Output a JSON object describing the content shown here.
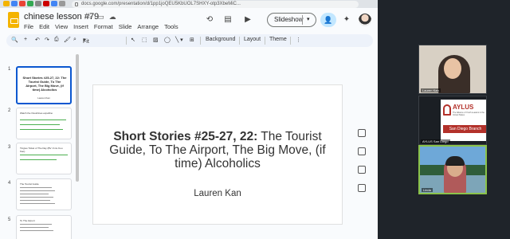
{
  "browser": {
    "url": "docs.google.com/presentation/d/1pp1joQEU5KbUOL7SHXY-otp3XbeMiC..."
  },
  "app": {
    "title": "chinese lesson #79",
    "menus": [
      "File",
      "Edit",
      "View",
      "Insert",
      "Format",
      "Slide",
      "Arrange",
      "Tools"
    ],
    "slideshow_label": "Slideshow",
    "zoom_label": "Fit",
    "toolbar_background": "Background",
    "toolbar_layout": "Layout",
    "toolbar_theme": "Theme"
  },
  "filmstrip": {
    "numbers": [
      "1",
      "2",
      "3",
      "4",
      "5"
    ],
    "thumb1_title": "Short Stories #25-27, 22: The Tourist Guide, To The Airport, The Big Move, (if time) Alcoholics",
    "thumb1_author": "Lauren Kan",
    "thumb2_text": "Watch the Ososhines expellino",
    "thumb3_text": "Tingwo Ticket of The Day (BV Ji niu Kou Kao)",
    "thumb4_text": "The Tourist Guide",
    "thumb5_text": "To The Airport"
  },
  "slide": {
    "title_bold": "Short Stories #25-27, 22:",
    "title_rest": " The Tourist Guide, To The Airport, The Big Move, (if time) Alcoholics",
    "author": "Lauren Kan"
  },
  "meet": {
    "tile1_name": "Lauren Kan",
    "tile2_name": "AYLUS San Diego",
    "tile3_name": "Linda",
    "aylus_title": "AYLUS",
    "aylus_subtitle": "The Alliance of Youth Leaders in the United States",
    "aylus_branch": "San Diego Branch"
  },
  "colors": {
    "accent": "#0b57d0",
    "doc_icon": "#f4b400",
    "aylus_red": "#b3312a",
    "speaker_border": "#8bc34a"
  }
}
